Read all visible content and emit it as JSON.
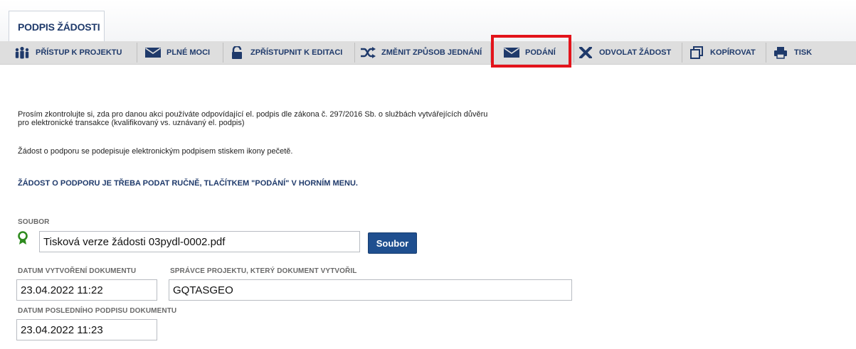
{
  "tab": {
    "label": "PODPIS ŽÁDOSTI"
  },
  "toolbar": {
    "items": [
      {
        "label": "PŘÍSTUP K PROJEKTU",
        "icon": "users-icon"
      },
      {
        "label": "PLNÉ MOCI",
        "icon": "envelope-icon"
      },
      {
        "label": "ZPŘÍSTUPNIT K EDITACI",
        "icon": "unlock-icon"
      },
      {
        "label": "ZMĚNIT ZPŮSOB JEDNÁNÍ",
        "icon": "shuffle-icon"
      },
      {
        "label": "PODÁNÍ",
        "icon": "envelope-icon"
      },
      {
        "label": "ODVOLAT ŽÁDOST",
        "icon": "close-icon"
      },
      {
        "label": "KOPÍROVAT",
        "icon": "copy-icon"
      },
      {
        "label": "TISK",
        "icon": "print-icon"
      }
    ],
    "highlight_color": "#e3141b"
  },
  "content": {
    "info_line1": "Prosím zkontrolujte si, zda pro danou akci používáte odpovídající el. podpis dle zákona č. 297/2016 Sb. o službách vytvářejících důvěru",
    "info_line2": "pro elektronické transakce (kvalifikovaný vs. uznávaný el. podpis)",
    "sign_info": "Žádost o podporu se podepisuje elektronickým podpisem stiskem ikony pečetě.",
    "notice": "ŽÁDOST O PODPORU JE TŘEBA PODAT RUČNĚ, TLAČÍTKEM \"PODÁNÍ\" V HORNÍM MENU.",
    "file_label": "SOUBOR",
    "file_value": "Tisková verze žádosti 03pydl-0002.pdf",
    "file_button": "Soubor",
    "created_label": "DATUM VYTVOŘENÍ DOKUMENTU",
    "created_value": "23.04.2022 11:22",
    "admin_label": "SPRÁVCE PROJEKTU, KTERÝ DOKUMENT VYTVOŘIL",
    "admin_value": "GQTASGEO",
    "signed_label": "DATUM POSLEDNÍHO PODPISU DOKUMENTU",
    "signed_value": "23.04.2022 11:23"
  },
  "colors": {
    "brand": "#1f3a6b",
    "button": "#1f4f8f",
    "seal": "#2e8b1e"
  }
}
